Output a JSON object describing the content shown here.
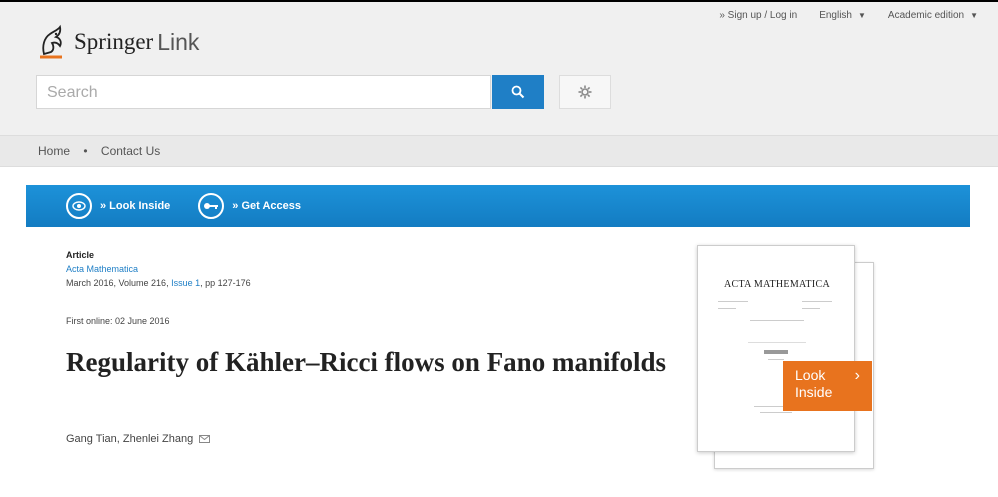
{
  "header": {
    "brand_main": "Springer",
    "brand_suffix": "Link",
    "top_links": {
      "signup": "» Sign up / Log in",
      "language": "English",
      "edition": "Academic edition"
    }
  },
  "search": {
    "placeholder": "Search"
  },
  "nav": {
    "home": "Home",
    "separator": "•",
    "contact": "Contact Us"
  },
  "action_bar": {
    "look_inside": "» Look Inside",
    "get_access": "» Get Access"
  },
  "article": {
    "type": "Article",
    "journal": "Acta Mathematica",
    "date_volume": "March 2016, Volume 216, ",
    "issue_link": "Issue 1",
    "pages": ", pp 127-176",
    "first_online": "First online: 02 June 2016",
    "title": "Regularity of Kähler–Ricci flows on Fano manifolds",
    "authors": "Gang Tian, Zhenlei Zhang"
  },
  "cover": {
    "journal_title": "ACTA MATHEMATICA",
    "look_inside_line1": "Look",
    "look_inside_line2": "Inside",
    "look_inside_arrow": "›"
  },
  "colors": {
    "brand_blue": "#1f7fc6",
    "action_bar_blue": "#1584cb",
    "look_inside_orange": "#e8731e"
  }
}
